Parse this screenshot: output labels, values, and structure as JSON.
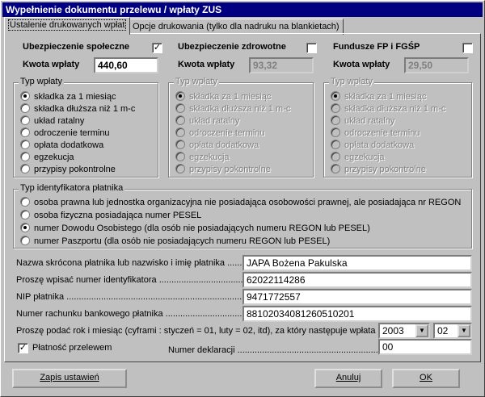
{
  "window": {
    "title": "Wypełnienie dokumentu przelewu / wpłaty ZUS"
  },
  "tabs": [
    {
      "label": "Ustalenie drukowanych wpłat"
    },
    {
      "label": "Opcje drukowania (tylko dla nadruku na blankietach)"
    }
  ],
  "insurance": [
    {
      "title": "Ubezpieczenie społeczne",
      "checked": "✓",
      "amount_label": "Kwota wpłaty",
      "amount": "440,60",
      "enabled": true
    },
    {
      "title": "Ubezpieczenie zdrowotne",
      "checked": "",
      "amount_label": "Kwota wpłaty",
      "amount": "93,32",
      "enabled": false
    },
    {
      "title": "Fundusze FP i FGŚP",
      "checked": "",
      "amount_label": "Kwota wpłaty",
      "amount": "29,50",
      "enabled": false
    }
  ],
  "payment_type": {
    "label": "Typ wpłaty",
    "options": [
      "składka za 1 miesiąc",
      "składka dłuższa niż 1 m-c",
      "układ ratalny",
      "odroczenie terminu",
      "opłata dodatkowa",
      "egzekucja",
      "przypisy pokontrolne"
    ],
    "selected_index": 0
  },
  "payer_id_type": {
    "label": "Typ identyfikatora płatnika",
    "options": [
      "osoba prawna lub jednostka organizacyjna nie posiadająca osobowości prawnej, ale posiadająca nr REGON",
      "osoba fizyczna posiadająca numer PESEL",
      "numer Dowodu Osobistego (dla osób nie posiadających numeru REGON lub PESEL)",
      "numer Paszportu (dla osób nie posiadających numeru REGON lub PESEL)"
    ],
    "selected_index": 2
  },
  "fields": {
    "name_label": "Nazwa skrócona płatnika lub nazwisko i imię płatnika ........",
    "name_value": "JAPA Bożena Pakulska",
    "id_label": "Proszę wpisać numer identyfikatora ..............................................",
    "id_value": "62022114286",
    "nip_label": "NIP płatnika ..........................................................................",
    "nip_value": "9471772557",
    "account_label": "Numer rachunku bankowego płatnika ...............................",
    "account_value": "88102034081260510201",
    "period_label": "Proszę podać rok i miesiąc (cyframi : styczeń = 01, luty = 02, itd), za który następuje wpłata .....",
    "year_value": "2003",
    "month_value": "02",
    "transfer_label": "Płatność przelewem",
    "transfer_checked": "✓",
    "declaration_label": "Numer deklaracji .............................................................",
    "declaration_value": "00"
  },
  "buttons": {
    "save_settings": "Zapis ustawień",
    "cancel": "Anuluj",
    "ok": "OK"
  }
}
